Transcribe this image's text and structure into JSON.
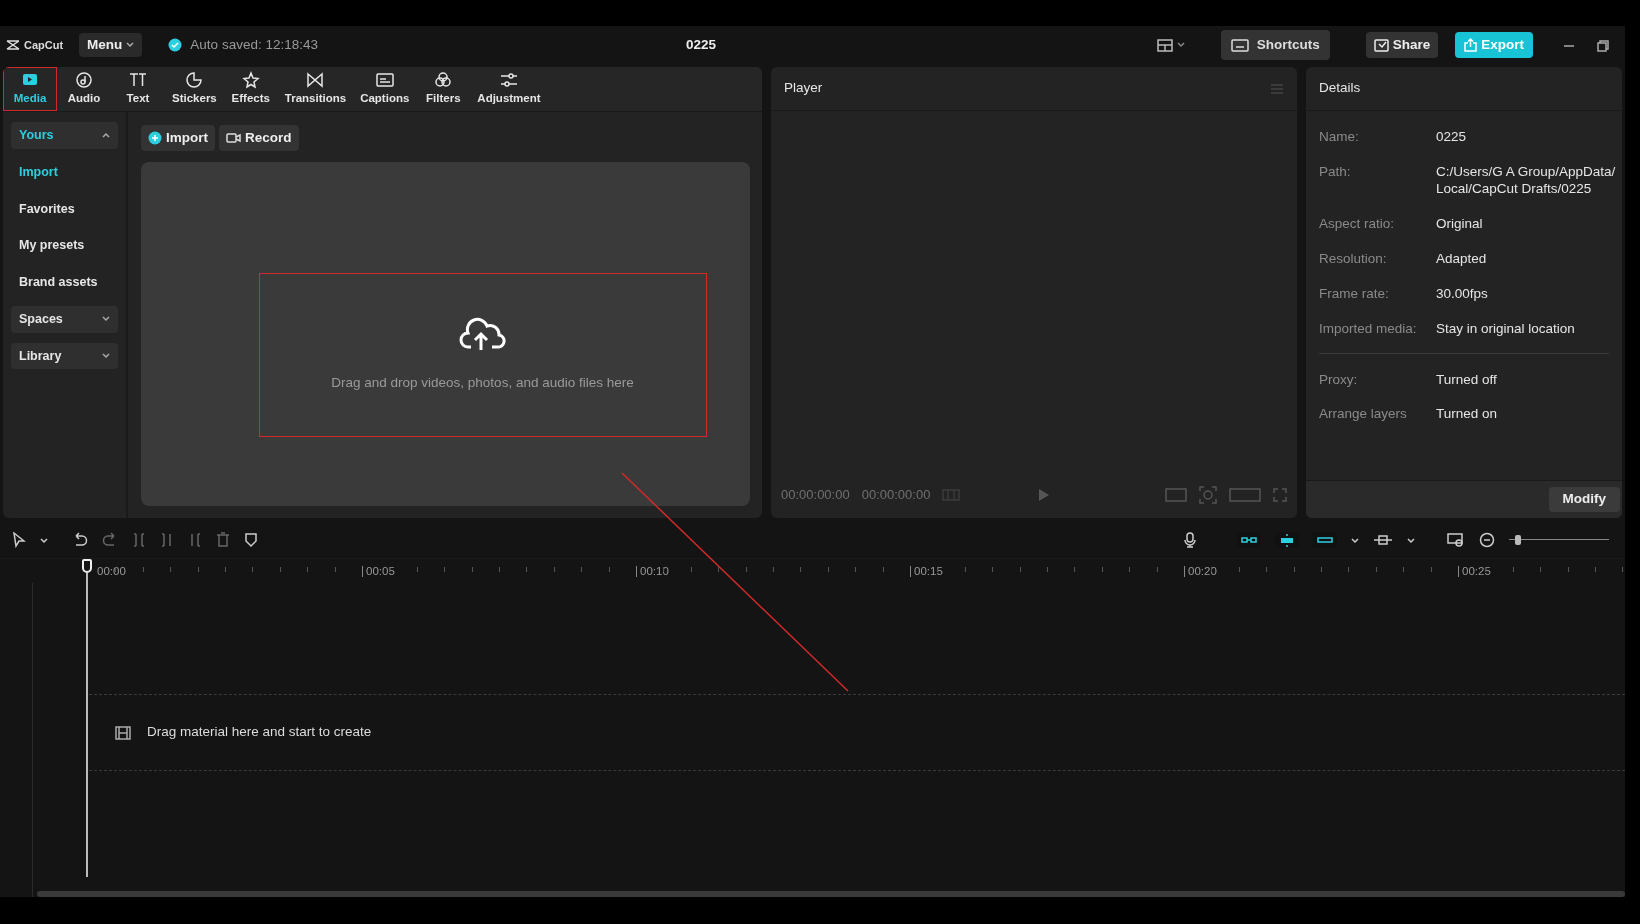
{
  "app": {
    "name": "CapCut"
  },
  "title_bar": {
    "menu": "Menu",
    "autosave": "Auto saved: 12:18:43",
    "project": "0225",
    "shortcuts": "Shortcuts",
    "share": "Share",
    "export": "Export"
  },
  "tool_tabs": [
    {
      "label": "Media",
      "selected": true,
      "highlighted": true
    },
    {
      "label": "Audio",
      "selected": false,
      "highlighted": false
    },
    {
      "label": "Text",
      "selected": false,
      "highlighted": false
    },
    {
      "label": "Stickers",
      "selected": false,
      "highlighted": false
    },
    {
      "label": "Effects",
      "selected": false,
      "highlighted": false
    },
    {
      "label": "Transitions",
      "selected": false,
      "highlighted": false
    },
    {
      "label": "Captions",
      "selected": false,
      "highlighted": false
    },
    {
      "label": "Filters",
      "selected": false,
      "highlighted": false
    },
    {
      "label": "Adjustment",
      "selected": false,
      "highlighted": false
    }
  ],
  "sidebar": [
    {
      "label": "Yours",
      "kind": "group",
      "expanded": true
    },
    {
      "label": "Import",
      "kind": "item",
      "selected": true
    },
    {
      "label": "Favorites",
      "kind": "item",
      "selected": false
    },
    {
      "label": "My presets",
      "kind": "item",
      "selected": false
    },
    {
      "label": "Brand assets",
      "kind": "item",
      "selected": false
    },
    {
      "label": "Spaces",
      "kind": "group",
      "expanded": false
    },
    {
      "label": "Library",
      "kind": "group",
      "expanded": false
    }
  ],
  "media_actions": [
    {
      "label": "Import",
      "kind": "import"
    },
    {
      "label": "Record",
      "kind": "record"
    }
  ],
  "drop_zone": {
    "text": "Drag and drop videos, photos, and audio files here",
    "highlighted": true
  },
  "player": {
    "title": "Player",
    "current_time": "00:00:00:00",
    "duration": "00:00:00:00"
  },
  "details": {
    "title": "Details",
    "sections": [
      [
        {
          "label": "Name:",
          "value": "0225"
        },
        {
          "label": "Path:",
          "value": "C:/Users/G A Group/AppData/\nLocal/CapCut Drafts/0225"
        },
        {
          "label": "Aspect ratio:",
          "value": "Original"
        },
        {
          "label": "Resolution:",
          "value": "Adapted"
        },
        {
          "label": "Frame rate:",
          "value": "30.00fps"
        },
        {
          "label": "Imported media:",
          "value": "Stay in original location"
        }
      ],
      [
        {
          "label": "Proxy:",
          "value": "Turned off"
        },
        {
          "label": "Arrange layers",
          "value": "Turned on"
        }
      ]
    ],
    "button": "Modify"
  },
  "timeline": {
    "zoom": {
      "level": 0.06
    },
    "ruler": [
      "00:00",
      "00:05",
      "00:10",
      "00:15",
      "00:20",
      "00:25"
    ],
    "empty_track": "Drag material here and start to create"
  }
}
